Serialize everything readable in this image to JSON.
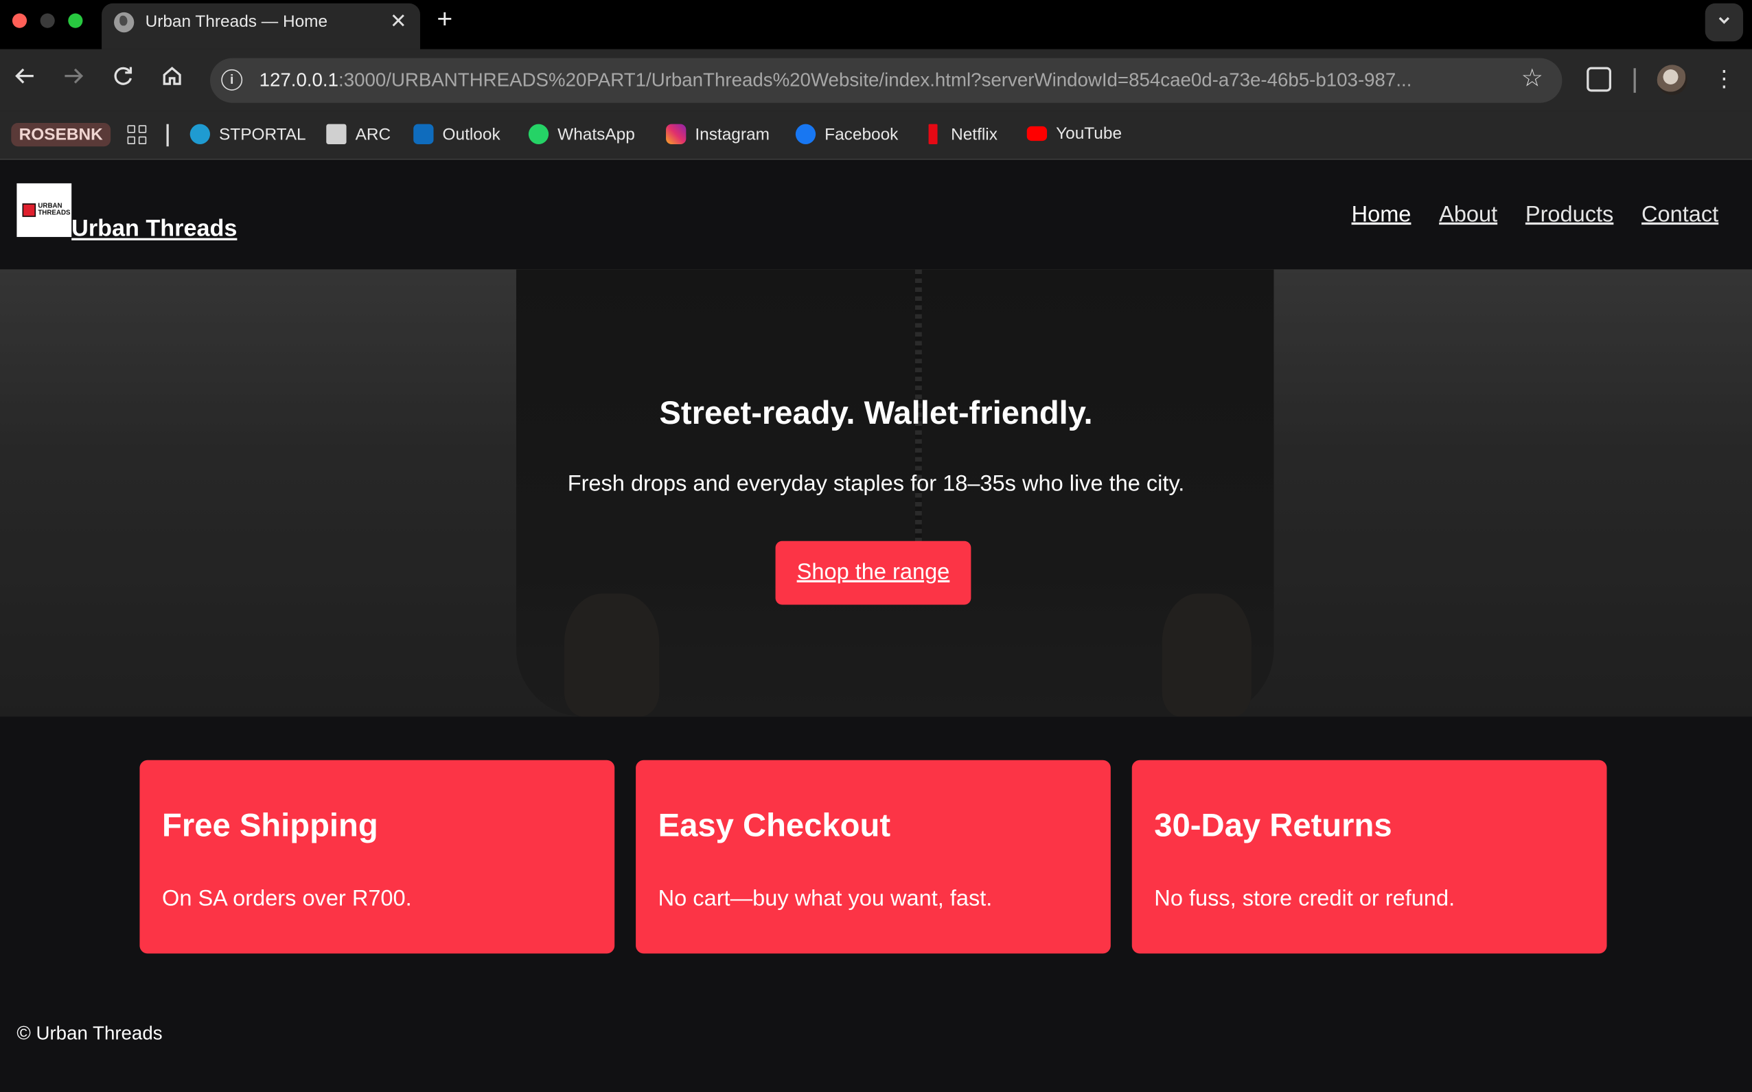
{
  "browser": {
    "tab_title": "Urban Threads — Home",
    "tab_close": "✕",
    "new_tab": "+",
    "url_host": "127.0.0.1",
    "url_rest": ":3000/URBANTHREADS%20PART1/UrbanThreads%20Website/index.html?serverWindowId=854cae0d-a73e-46b5-b103-987...",
    "bookmarks": [
      {
        "label": "ROSEBNK"
      },
      {
        "label": "STPORTAL",
        "color": "#1f9bd1"
      },
      {
        "label": "ARC",
        "color": "#d0d0d0"
      },
      {
        "label": "Outlook",
        "color": "#0f6cbd"
      },
      {
        "label": "WhatsApp",
        "color": "#25d366"
      },
      {
        "label": "Instagram",
        "color": "#e1306c"
      },
      {
        "label": "Facebook",
        "color": "#1877f2"
      },
      {
        "label": "Netflix",
        "color": "#e50914"
      },
      {
        "label": "YouTube",
        "color": "#ff0000"
      }
    ]
  },
  "site": {
    "logo_text": "URBAN THREADS",
    "brand": "Urban Threads",
    "nav": [
      "Home",
      "About",
      "Products",
      "Contact"
    ],
    "hero": {
      "title": "Street-ready. Wallet-friendly.",
      "subtitle": "Fresh drops and everyday staples for 18–35s who live the city.",
      "cta": "Shop the range"
    },
    "features": [
      {
        "title": "Free Shipping",
        "text": "On SA orders over R700."
      },
      {
        "title": "Easy Checkout",
        "text": "No cart—buy what you want, fast."
      },
      {
        "title": "30-Day Returns",
        "text": "No fuss, store credit or refund."
      }
    ],
    "footer": "© Urban Threads"
  },
  "colors": {
    "accent": "#fc3446",
    "page_bg": "#111113"
  }
}
